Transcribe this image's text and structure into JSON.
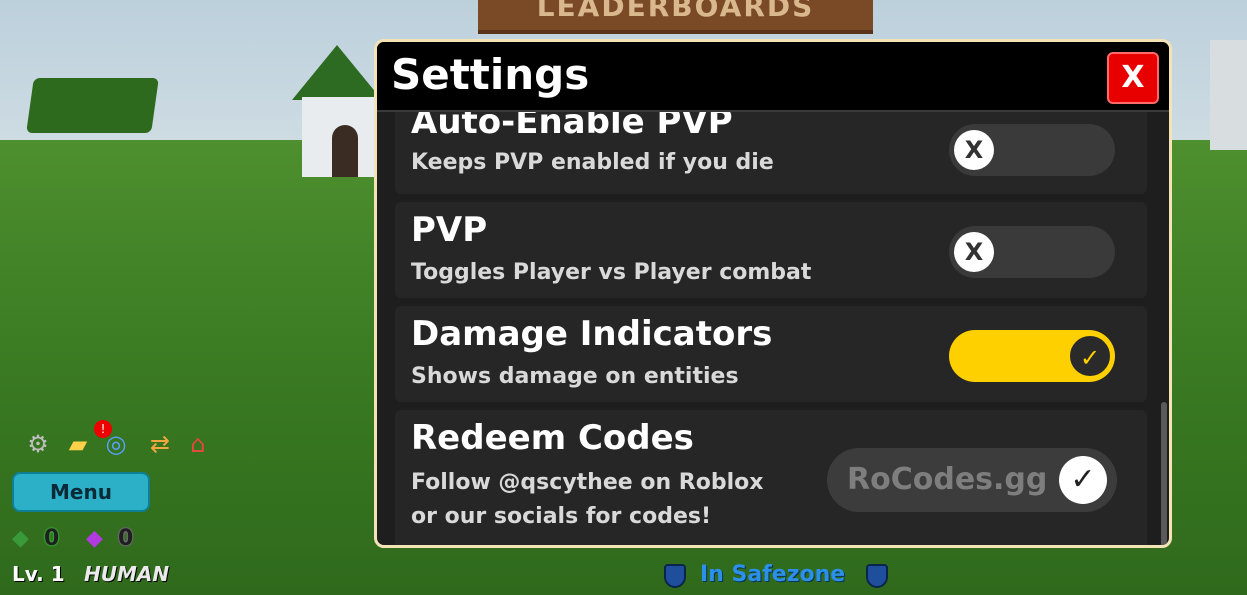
{
  "background": {
    "leaderboard_sign": "LEADERBOARDS"
  },
  "settings": {
    "title": "Settings",
    "close_label": "X",
    "rows": [
      {
        "title": "Auto-Enable PVP",
        "desc": "Keeps PVP enabled if you die",
        "enabled": false,
        "knob": "X"
      },
      {
        "title": "PVP",
        "desc": "Toggles Player vs Player combat",
        "enabled": false,
        "knob": "X"
      },
      {
        "title": "Damage Indicators",
        "desc": "Shows damage on entities",
        "enabled": true,
        "knob": "✓"
      }
    ],
    "redeem": {
      "title": "Redeem Codes",
      "desc_line1": "Follow @qscythee on Roblox",
      "desc_line2": "or our socials for codes!",
      "input_value": "RoCodes.gg",
      "submit_glyph": "✓"
    }
  },
  "hud": {
    "icons": [
      "gear-icon",
      "chat-icon",
      "compass-icon",
      "trade-icon",
      "home-icon"
    ],
    "notification_badge": "!",
    "menu_label": "Menu",
    "gold_count": "0",
    "gem_count": "0",
    "level": "Lv. 1",
    "race": "HUMAN",
    "zone_status": "In Safezone"
  },
  "colors": {
    "accent_toggle_on": "#ffd000",
    "close_button": "#e80000",
    "panel_border": "#f4e3b5",
    "safezone_text": "#2c8fe8"
  }
}
